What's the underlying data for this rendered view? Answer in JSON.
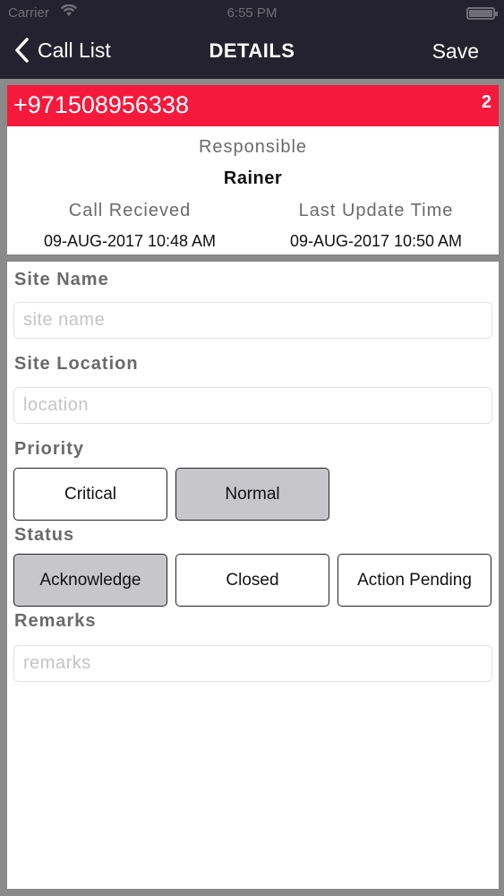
{
  "status_bar": {
    "carrier": "Carrier",
    "time": "6:55 PM"
  },
  "nav": {
    "back_label": "Call List",
    "title": "DETAILS",
    "save_label": "Save"
  },
  "call": {
    "phone": "+971508956338",
    "badge": "2",
    "responsible_label": "Responsible",
    "responsible_name": "Rainer",
    "received_label": "Call Recieved",
    "received_value": "09-AUG-2017 10:48 AM",
    "updated_label": "Last Update Time",
    "updated_value": "09-AUG-2017 10:50 AM"
  },
  "colors": {
    "nav_bg": "#23222e",
    "accent_red": "#f5193b",
    "selected_btn": "#c7c6cb"
  },
  "form": {
    "site_name": {
      "label": "Site Name",
      "placeholder": "site name",
      "value": ""
    },
    "site_location": {
      "label": "Site Location",
      "placeholder": "location",
      "value": ""
    },
    "priority": {
      "label": "Priority",
      "options": [
        "Critical",
        "Normal"
      ],
      "selected": "Normal"
    },
    "status": {
      "label": "Status",
      "options": [
        "Acknowledge",
        "Closed",
        "Action Pending"
      ],
      "selected": "Acknowledge"
    },
    "remarks": {
      "label": "Remarks",
      "placeholder": "remarks",
      "value": ""
    }
  }
}
